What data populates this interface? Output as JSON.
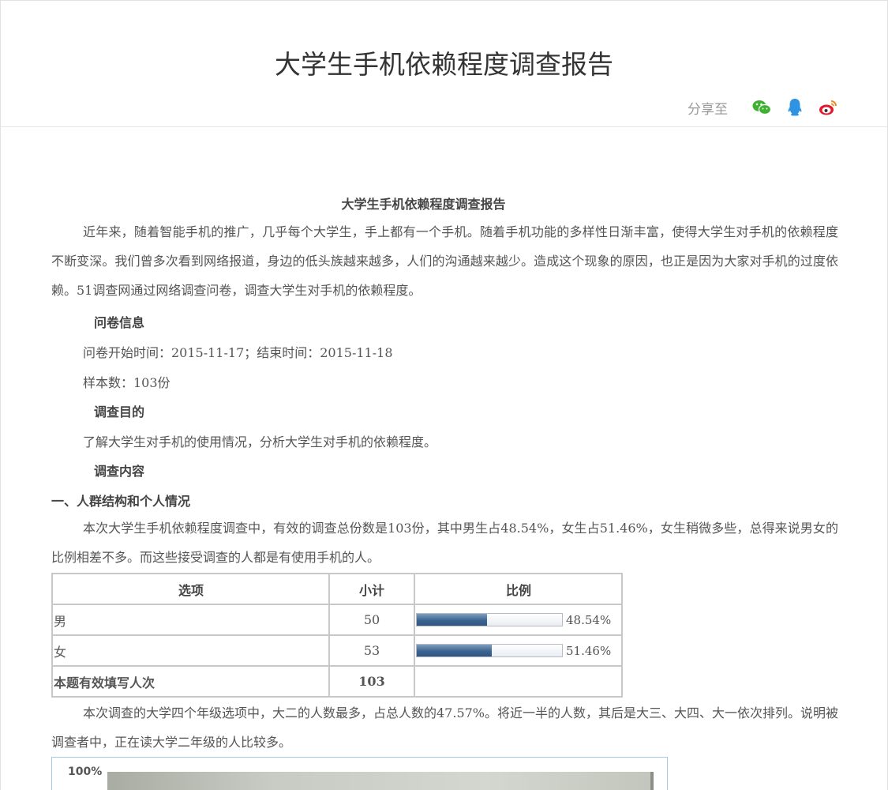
{
  "header": {
    "title": "大学生手机依赖程度调查报告",
    "share_label": "分享至",
    "share_icons": [
      "wechat-icon",
      "qq-icon",
      "weibo-icon"
    ]
  },
  "doc": {
    "title": "大学生手机依赖程度调查报告",
    "intro": "近年来，随着智能手机的推广，几乎每个大学生，手上都有一个手机。随着手机功能的多样性日渐丰富，使得大学生对手机的依赖程度不断变深。我们曾多次看到网络报道，身边的低头族越来越多，人们的沟通越来越少。造成这个现象的原因，也正是因为大家对手机的过度依赖。51调查网通过网络调查问卷，调查大学生对手机的依赖程度。",
    "heading_info": "问卷信息",
    "info_time": "问卷开始时间：2015-11-17；结束时间：2015-11-18",
    "info_sample": "样本数：103份",
    "heading_purpose": "调查目的",
    "purpose_text": "了解大学生对手机的使用情况，分析大学生对手机的依赖程度。",
    "heading_content": "调查内容",
    "section1_title": "一、人群结构和个人情况",
    "section1_text": "本次大学生手机依赖程度调查中，有效的调查总份数是103份，其中男生占48.54%，女生占51.46%，女生稍微多些，总得来说男女的比例相差不多。而这些接受调查的人都是有使用手机的人。",
    "section1_text2": "本次调查的大学四个年级选项中，大二的人数最多，占总人数的47.57%。将近一半的人数，其后是大三、大四、大一依次排列。说明被调查者中，正在读大学二年级的人比较多。",
    "chart_tick": "100%"
  },
  "table": {
    "headers": [
      "选项",
      "小计",
      "比例"
    ],
    "rows": [
      {
        "option": "男",
        "count": "50",
        "percent": "48.54%",
        "fraction": 0.4854
      },
      {
        "option": "女",
        "count": "53",
        "percent": "51.46%",
        "fraction": 0.5146
      }
    ],
    "total_label": "本题有效填写人次",
    "total_count": "103"
  }
}
